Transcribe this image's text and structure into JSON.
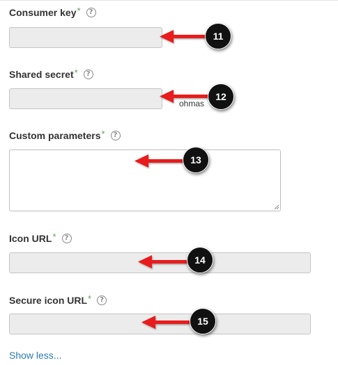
{
  "fields": [
    {
      "label": "Consumer key",
      "required_mark": "*",
      "help_icon": "question-circle-icon",
      "value": ""
    },
    {
      "label": "Shared secret",
      "required_mark": "*",
      "help_icon": "question-circle-icon",
      "value": ""
    },
    {
      "label": "Custom parameters",
      "required_mark": "*",
      "help_icon": "question-circle-icon",
      "value": ""
    },
    {
      "label": "Icon URL",
      "required_mark": "*",
      "help_icon": "question-circle-icon",
      "value": ""
    },
    {
      "label": "Secure icon URL",
      "required_mark": "*",
      "help_icon": "question-circle-icon",
      "value": ""
    }
  ],
  "help_glyph": "?",
  "partial_text": "ohmas",
  "annotations": [
    "11",
    "12",
    "13",
    "14",
    "15"
  ],
  "show_less_link": "Show less...",
  "colors": {
    "required": "#57a64a",
    "link": "#2a7ab8",
    "annotation_arrow": "#e81c1c",
    "annotation_badge": "#111111"
  }
}
